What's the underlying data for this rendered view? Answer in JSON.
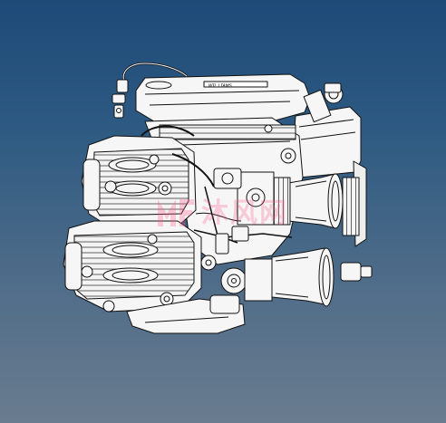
{
  "viewport": {
    "background_top": "#1d4a78",
    "background_bottom": "#6a7c8f"
  },
  "model": {
    "subject": "engine-assembly-drawing",
    "line_color": "#111111",
    "fill_color": "#f6f6f6"
  },
  "watermark": {
    "text": "沐风网",
    "logo": "mfcad-logo-icon",
    "color": "#ff5a8c"
  }
}
